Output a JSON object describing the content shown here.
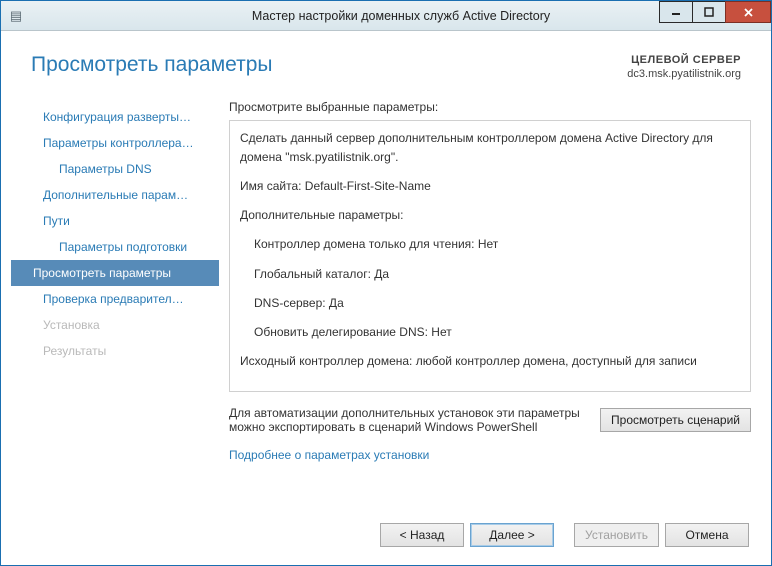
{
  "titlebar": {
    "title": "Мастер настройки доменных служб Active Directory"
  },
  "header": {
    "page_title": "Просмотреть параметры",
    "server_label": "ЦЕЛЕВОЙ СЕРВЕР",
    "server_name": "dc3.msk.pyatilistnik.org"
  },
  "nav": {
    "items": [
      {
        "label": "Конфигурация разверты…",
        "indent": false,
        "sel": false,
        "dis": false
      },
      {
        "label": "Параметры контроллера…",
        "indent": false,
        "sel": false,
        "dis": false
      },
      {
        "label": "Параметры DNS",
        "indent": true,
        "sel": false,
        "dis": false
      },
      {
        "label": "Дополнительные парам…",
        "indent": false,
        "sel": false,
        "dis": false
      },
      {
        "label": "Пути",
        "indent": false,
        "sel": false,
        "dis": false
      },
      {
        "label": "Параметры подготовки",
        "indent": true,
        "sel": false,
        "dis": false
      },
      {
        "label": "Просмотреть параметры",
        "indent": false,
        "sel": true,
        "dis": false
      },
      {
        "label": "Проверка предварител…",
        "indent": false,
        "sel": false,
        "dis": false
      },
      {
        "label": "Установка",
        "indent": false,
        "sel": false,
        "dis": true
      },
      {
        "label": "Результаты",
        "indent": false,
        "sel": false,
        "dis": true
      }
    ]
  },
  "main": {
    "instruction": "Просмотрите выбранные параметры:",
    "lines": [
      "Сделать данный сервер дополнительным контроллером домена Active Directory для домена \"msk.pyatilistnik.org\".",
      "Имя сайта: Default-First-Site-Name",
      "Дополнительные параметры:",
      "Контроллер домена только для чтения: Нет",
      "Глобальный каталог: Да",
      "DNS-сервер: Да",
      "Обновить делегирование DNS: Нет",
      "Исходный контроллер домена: любой контроллер домена, доступный для записи"
    ],
    "automation_text": "Для автоматизации дополнительных установок эти параметры можно экспортировать в сценарий Windows PowerShell",
    "view_script_btn": "Просмотреть сценарий",
    "more_link": "Подробнее о параметрах установки"
  },
  "footer": {
    "back": "< Назад",
    "next": "Далее >",
    "install": "Установить",
    "cancel": "Отмена"
  }
}
